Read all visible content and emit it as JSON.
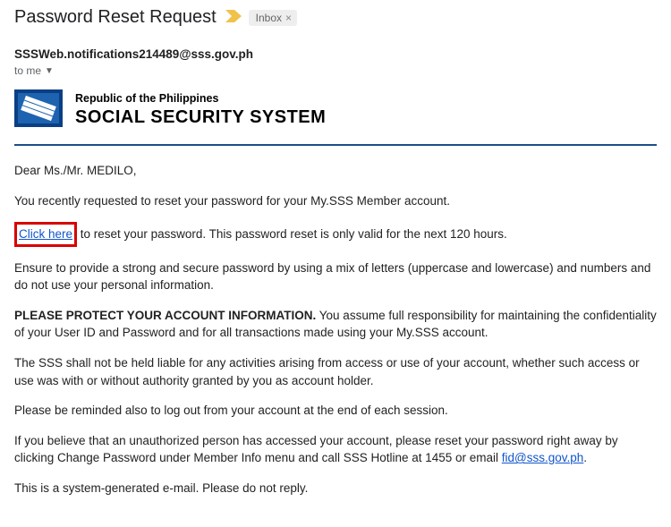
{
  "header": {
    "subject": "Password Reset Request",
    "label": "Inbox",
    "label_close": "×"
  },
  "sender": {
    "from": "SSSWeb.notifications214489@sss.gov.ph",
    "to": "to me"
  },
  "org": {
    "republic": "Republic of the Philippines",
    "name": "SOCIAL SECURITY SYSTEM"
  },
  "body": {
    "salutation": "Dear Ms./Mr. MEDILO,",
    "intro": "You recently requested to reset your password for your My.SSS Member account.",
    "click_here": "Click here",
    "click_here_rest": " to reset your password. This password reset is only valid for the next 120 hours.",
    "ensure": "Ensure to provide a strong and secure password by using a mix of letters (uppercase and lowercase) and numbers and do not use your personal information.",
    "protect_bold": "PLEASE PROTECT YOUR ACCOUNT INFORMATION.",
    "protect_rest": " You assume full responsibility for maintaining the confidentiality of your User ID and Password and for all transactions made using your My.SSS account.",
    "liable": "The SSS shall not be held liable for any activities arising from access or use of your account, whether such access or use was with or without authority granted by you as account holder.",
    "logout": "Please be reminded also to log out from your account at the end of each session.",
    "unauth_pre": "If you believe that an unauthorized person has accessed your account, please reset your password right away by clicking Change Password under Member Info menu and call SSS Hotline at 1455 or email ",
    "unauth_link": "fid@sss.gov.ph",
    "unauth_post": ".",
    "footer": "This is a system-generated e-mail. Please do not reply."
  }
}
